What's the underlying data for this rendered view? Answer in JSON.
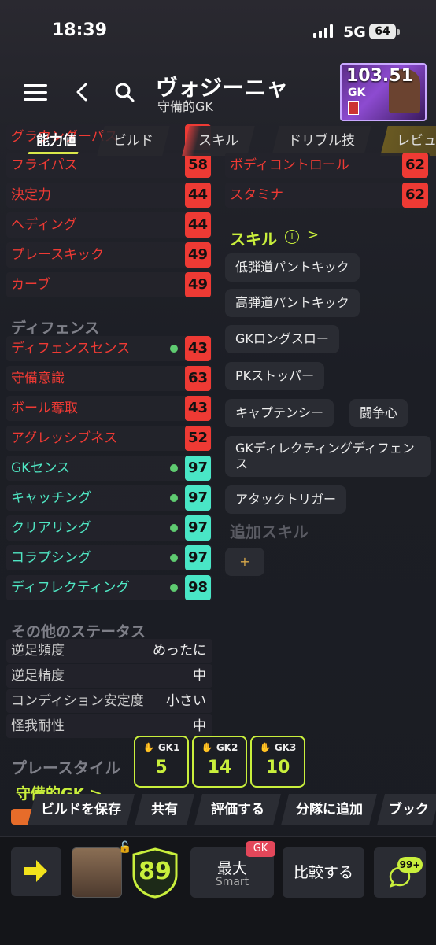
{
  "status_bar": {
    "time": "18:39",
    "network": "5G",
    "battery": "64"
  },
  "header": {
    "player_name": "ヴォジーニャ",
    "position_label": "守備的GK"
  },
  "player_card": {
    "rating": "103.51",
    "position": "GK"
  },
  "tabs": [
    {
      "label": "能力値"
    },
    {
      "label": "ビルド"
    },
    {
      "label": "スキル"
    },
    {
      "label": "ドリブル技"
    },
    {
      "label": "レビュ"
    }
  ],
  "left_stats": [
    {
      "label": "グラウンダーパス",
      "value": "",
      "color": "red"
    },
    {
      "label": "フライパス",
      "value": "58",
      "color": "red"
    },
    {
      "label": "決定力",
      "value": "44",
      "color": "red"
    },
    {
      "label": "ヘディング",
      "value": "44",
      "color": "red"
    },
    {
      "label": "プレースキック",
      "value": "49",
      "color": "red"
    },
    {
      "label": "カーブ",
      "value": "49",
      "color": "red"
    }
  ],
  "defense": {
    "title": "ディフェンス",
    "stats": [
      {
        "label": "ディフェンスセンス",
        "value": "43",
        "boosted": true
      },
      {
        "label": "守備意識",
        "value": "63",
        "boosted": false
      },
      {
        "label": "ボール奪取",
        "value": "43",
        "boosted": false
      },
      {
        "label": "アグレッシブネス",
        "value": "52",
        "boosted": false
      },
      {
        "label": "GKセンス",
        "value": "97",
        "boosted": true
      },
      {
        "label": "キャッチング",
        "value": "97",
        "boosted": true
      },
      {
        "label": "クリアリング",
        "value": "97",
        "boosted": true
      },
      {
        "label": "コラプシング",
        "value": "97",
        "boosted": true
      },
      {
        "label": "ディフレクティング",
        "value": "98",
        "boosted": true
      }
    ]
  },
  "right_stats": [
    {
      "label": "ボディコントロール",
      "value": "62"
    },
    {
      "label": "スタミナ",
      "value": "62"
    }
  ],
  "skills": {
    "title": "スキル",
    "items": [
      "低弾道パントキック",
      "高弾道パントキック",
      "GKロングスロー",
      "PKストッパー",
      "キャプテンシー",
      "闘争心",
      "GKディレクティングディフェンス",
      "アタックトリガー"
    ],
    "additional_title": "追加スキル",
    "add_label": "+"
  },
  "other_status": {
    "title": "その他のステータス",
    "rows": [
      {
        "key": "逆足頻度",
        "value": "めったに"
      },
      {
        "key": "逆足精度",
        "value": "中"
      },
      {
        "key": "コンディション安定度",
        "value": "小さい"
      },
      {
        "key": "怪我耐性",
        "value": "中"
      }
    ]
  },
  "playstyle": {
    "title": "プレースタイル",
    "value": "守備的GK >"
  },
  "gk_ratings": [
    {
      "label": "GK1",
      "value": "5"
    },
    {
      "label": "GK2",
      "value": "14"
    },
    {
      "label": "GK3",
      "value": "10"
    }
  ],
  "action_bar": {
    "save": "ビルドを保存",
    "share": "共有",
    "rate": "評価する",
    "add_squad": "分隊に追加",
    "bookmark": "ブック"
  },
  "bottom_bar": {
    "overall": "89",
    "max_label": "最大",
    "max_sub": "Smart",
    "max_tag": "GK",
    "compare": "比較する",
    "chat_badge": "99+"
  },
  "colors": {
    "accent": "#c9ef3c",
    "red_stat": "#ee3a34",
    "green_stat": "#49e6c6"
  }
}
